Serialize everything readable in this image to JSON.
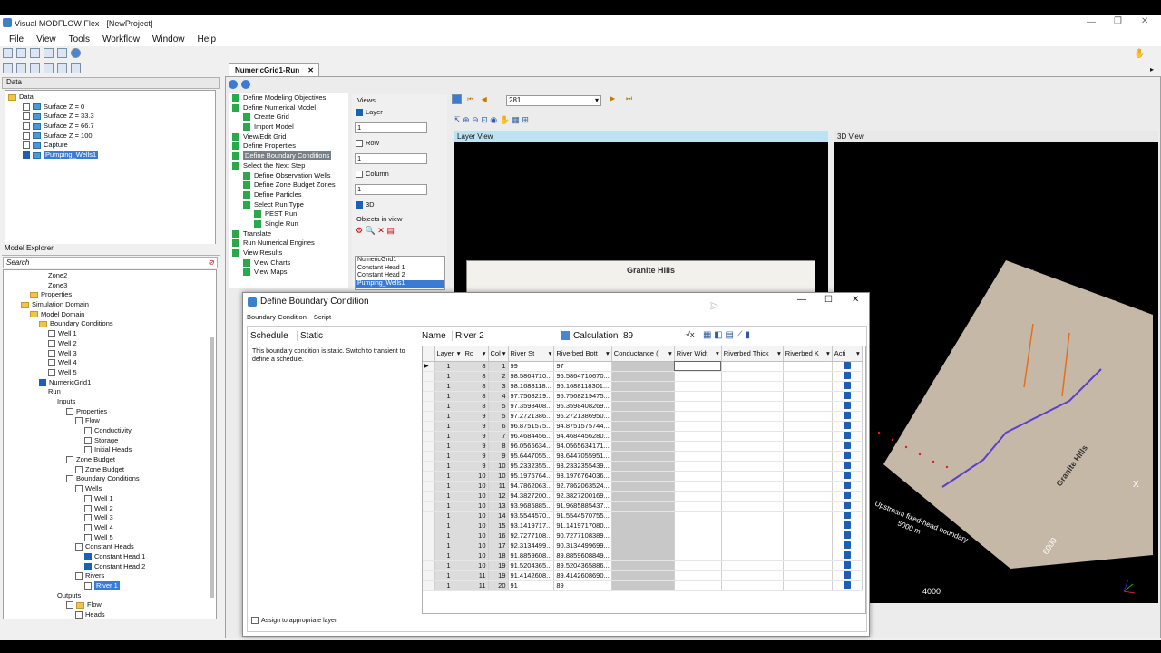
{
  "app": {
    "title": "Visual MODFLOW Flex - [NewProject]"
  },
  "menu": [
    "File",
    "View",
    "Tools",
    "Workflow",
    "Window",
    "Help"
  ],
  "data_panel": {
    "tab": "Data",
    "items": [
      {
        "label": "Data",
        "indent": 0,
        "checked": false,
        "folder": true
      },
      {
        "label": "Surface Z = 0",
        "indent": 2,
        "checked": false
      },
      {
        "label": "Surface Z = 33.3",
        "indent": 2,
        "checked": false
      },
      {
        "label": "Surface Z = 66.7",
        "indent": 2,
        "checked": false
      },
      {
        "label": "Surface Z = 100",
        "indent": 2,
        "checked": false
      },
      {
        "label": "Capture",
        "indent": 2,
        "checked": false
      },
      {
        "label": "Pumping_Wells1",
        "indent": 2,
        "checked": true,
        "selected": true
      }
    ]
  },
  "explorer": {
    "title": "Model Explorer",
    "search": "Search",
    "items": [
      {
        "label": "Zone2",
        "indent": 4
      },
      {
        "label": "Zone3",
        "indent": 4
      },
      {
        "label": "Properties",
        "indent": 2,
        "folder": true
      },
      {
        "label": "Simulation Domain",
        "indent": 1,
        "folder": true
      },
      {
        "label": "Model Domain",
        "indent": 2,
        "folder": true
      },
      {
        "label": "Boundary Conditions",
        "indent": 3,
        "folder": true
      },
      {
        "label": "Well 1",
        "indent": 4,
        "cb": true
      },
      {
        "label": "Well 2",
        "indent": 4,
        "cb": true
      },
      {
        "label": "Well 3",
        "indent": 4,
        "cb": true
      },
      {
        "label": "Well 4",
        "indent": 4,
        "cb": true
      },
      {
        "label": "Well 5",
        "indent": 4,
        "cb": true
      },
      {
        "label": "NumericGrid1",
        "indent": 3,
        "cb": true,
        "checked": true
      },
      {
        "label": "Run",
        "indent": 4
      },
      {
        "label": "Inputs",
        "indent": 5
      },
      {
        "label": "Properties",
        "indent": 6,
        "cb": true
      },
      {
        "label": "Flow",
        "indent": 7,
        "cb": true
      },
      {
        "label": "Conductivity",
        "indent": 8,
        "cb": true
      },
      {
        "label": "Storage",
        "indent": 8,
        "cb": true
      },
      {
        "label": "Initial Heads",
        "indent": 8,
        "cb": true
      },
      {
        "label": "Zone Budget",
        "indent": 6,
        "cb": true
      },
      {
        "label": "Zone Budget",
        "indent": 7,
        "cb": true
      },
      {
        "label": "Boundary Conditions",
        "indent": 6,
        "cb": true
      },
      {
        "label": "Wells",
        "indent": 7,
        "cb": true
      },
      {
        "label": "Well 1",
        "indent": 8,
        "cb": true
      },
      {
        "label": "Well 2",
        "indent": 8,
        "cb": true
      },
      {
        "label": "Well 3",
        "indent": 8,
        "cb": true
      },
      {
        "label": "Well 4",
        "indent": 8,
        "cb": true
      },
      {
        "label": "Well 5",
        "indent": 8,
        "cb": true
      },
      {
        "label": "Constant Heads",
        "indent": 7,
        "cb": true
      },
      {
        "label": "Constant Head 1",
        "indent": 8,
        "cb": true,
        "checked": true
      },
      {
        "label": "Constant Head 2",
        "indent": 8,
        "cb": true,
        "checked": true
      },
      {
        "label": "Rivers",
        "indent": 7,
        "cb": true
      },
      {
        "label": "River 1",
        "indent": 8,
        "cb": true,
        "selected": true
      },
      {
        "label": "Outputs",
        "indent": 5
      },
      {
        "label": "Flow",
        "indent": 6,
        "cb": true,
        "folder": true
      },
      {
        "label": "Heads",
        "indent": 7,
        "cb": true
      }
    ]
  },
  "doc_tab": "NumericGrid1-Run",
  "workflow": [
    {
      "label": "Define Modeling Objectives",
      "indent": 0
    },
    {
      "label": "Define Numerical Model",
      "indent": 0
    },
    {
      "label": "Create Grid",
      "indent": 1
    },
    {
      "label": "Import Model",
      "indent": 1
    },
    {
      "label": "View/Edit Grid",
      "indent": 0
    },
    {
      "label": "Define Properties",
      "indent": 0
    },
    {
      "label": "Define Boundary Conditions",
      "indent": 0,
      "selected": true
    },
    {
      "label": "Select the Next Step",
      "indent": 0
    },
    {
      "label": "Define Observation Wells",
      "indent": 1
    },
    {
      "label": "Define Zone Budget Zones",
      "indent": 1
    },
    {
      "label": "Define Particles",
      "indent": 1
    },
    {
      "label": "Select Run Type",
      "indent": 1
    },
    {
      "label": "PEST Run",
      "indent": 2
    },
    {
      "label": "Single Run",
      "indent": 2
    },
    {
      "label": "Translate",
      "indent": 0
    },
    {
      "label": "Run Numerical Engines",
      "indent": 0
    },
    {
      "label": "View Results",
      "indent": 0
    },
    {
      "label": "View Charts",
      "indent": 1
    },
    {
      "label": "View Maps",
      "indent": 1
    }
  ],
  "views": {
    "title": "Views",
    "layer": "Layer",
    "row": "Row",
    "column": "Column",
    "three_d": "3D",
    "val": "1",
    "objects_title": "Objects in view",
    "objects": [
      "NumericGrid1",
      "Constant Head 1",
      "Constant Head 2",
      "Pumping_Wells1"
    ]
  },
  "nav": {
    "layer_value": "281"
  },
  "layer_view": {
    "title": "Layer View",
    "map_label": "Granite Hills"
  },
  "view3d": {
    "title": "3D View",
    "labels": [
      "Granite Hills",
      "Upstream fixed-head boundary",
      "5000 m",
      "6000",
      "4000",
      "X"
    ]
  },
  "dialog": {
    "title": "Define Boundary Condition",
    "tabs": [
      "Boundary Condition",
      "Script"
    ],
    "schedule_label": "Schedule",
    "schedule_value": "Static",
    "schedule_note": "This boundary condition is static. Switch to transient to define a schedule.",
    "name_label": "Name",
    "name_value": "River 2",
    "calc_label": "Calculation",
    "calc_value": "89",
    "assign_label": "Assign to appropriate layer",
    "columns": [
      "Layer",
      "Ro",
      "Col",
      "River St",
      "Riverbed Bott",
      "Conductance (",
      "River Widt",
      "Riverbed Thick",
      "Riverbed K",
      "Acti"
    ],
    "rows": [
      [
        "1",
        "8",
        "1",
        "99",
        "97"
      ],
      [
        "1",
        "8",
        "2",
        "98.5864710...",
        "96.5864710670..."
      ],
      [
        "1",
        "8",
        "3",
        "98.1688118...",
        "96.1688118301..."
      ],
      [
        "1",
        "8",
        "4",
        "97.7568219...",
        "95.7568219475..."
      ],
      [
        "1",
        "8",
        "5",
        "97.3598408...",
        "95.3598408269..."
      ],
      [
        "1",
        "9",
        "5",
        "97.2721386...",
        "95.2721386950..."
      ],
      [
        "1",
        "9",
        "6",
        "96.8751575...",
        "94.8751575744..."
      ],
      [
        "1",
        "9",
        "7",
        "96.4684456...",
        "94.4684456280..."
      ],
      [
        "1",
        "9",
        "8",
        "96.0565634...",
        "94.0565634171..."
      ],
      [
        "1",
        "9",
        "9",
        "95.6447055...",
        "93.6447055951..."
      ],
      [
        "1",
        "9",
        "10",
        "95.2332355...",
        "93.2332355439..."
      ],
      [
        "1",
        "10",
        "10",
        "95.1976764...",
        "93.1976764036..."
      ],
      [
        "1",
        "10",
        "11",
        "94.7862063...",
        "92.7862063524..."
      ],
      [
        "1",
        "10",
        "12",
        "94.3827200...",
        "92.3827200169..."
      ],
      [
        "1",
        "10",
        "13",
        "93.9685885...",
        "91.9685885437..."
      ],
      [
        "1",
        "10",
        "14",
        "93.5544570...",
        "91.5544570755..."
      ],
      [
        "1",
        "10",
        "15",
        "93.1419717...",
        "91.1419717080..."
      ],
      [
        "1",
        "10",
        "16",
        "92.7277108...",
        "90.7277108389..."
      ],
      [
        "1",
        "10",
        "17",
        "92.3134499...",
        "90.3134499699..."
      ],
      [
        "1",
        "10",
        "18",
        "91.8859608...",
        "89.8859608849..."
      ],
      [
        "1",
        "10",
        "19",
        "91.5204365...",
        "89.5204365886..."
      ],
      [
        "1",
        "11",
        "19",
        "91.4142608...",
        "89.4142608690..."
      ],
      [
        "1",
        "11",
        "20",
        "91",
        "89"
      ]
    ]
  }
}
